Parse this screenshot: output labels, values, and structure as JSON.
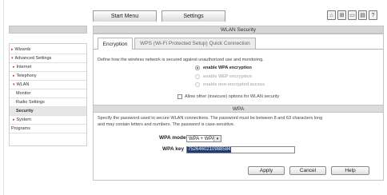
{
  "top_tabs": [
    {
      "label": "Start Menu"
    },
    {
      "label": "Settings"
    }
  ],
  "toolbar_icons": [
    "home-icon",
    "network-icon",
    "computer-icon",
    "printer-icon",
    "help-icon"
  ],
  "sidebar": {
    "items": [
      {
        "label": "Wizards",
        "marker": "▸"
      },
      {
        "label": "Advanced Settings",
        "marker": "▾"
      },
      {
        "label": "Internet",
        "marker": "▸"
      },
      {
        "label": "Telephony",
        "marker": "▸"
      },
      {
        "label": "WLAN",
        "marker": "▾"
      },
      {
        "label": "Monitor",
        "marker": ""
      },
      {
        "label": "Radio Settings",
        "marker": ""
      },
      {
        "label": "Security",
        "marker": ""
      },
      {
        "label": "System",
        "marker": "▸"
      },
      {
        "label": "Programs",
        "marker": ""
      }
    ]
  },
  "main": {
    "header_title": "WLAN Security",
    "tabs": [
      {
        "label": "Encryption"
      },
      {
        "label": "WPS (Wi-Fi Protected Setup) Quick Connection"
      }
    ],
    "description": "Define how the wireless network is secured against unauthorized use and monitoring.",
    "options": [
      {
        "label": "enable WPA encryption"
      },
      {
        "label": "enable WEP encryption"
      },
      {
        "label": "enable non-encrypted access"
      }
    ],
    "allow_other_label": "Allow other (insecure) options for WLAN security",
    "wpa_section": "WPA",
    "wpa_text_1": "Specify the password used to secure WLAN connections. The password must be between 8 and 63 characters long",
    "wpa_text_2": "and may contain letters and numbers. The password is case-sensitive.",
    "wpa_mode_label": "WPA mode",
    "wpa_mode_value": "WPA + WPA2",
    "wpa_key_label": "WPA key",
    "wpa_key_value": "7526460210988584",
    "buttons": {
      "apply": "Apply",
      "cancel": "Cancel",
      "help": "Help"
    }
  },
  "colors": {
    "accent_red": "#c0392b",
    "selection_blue": "#1d3c78",
    "header_gray": "#d6d6d6"
  }
}
